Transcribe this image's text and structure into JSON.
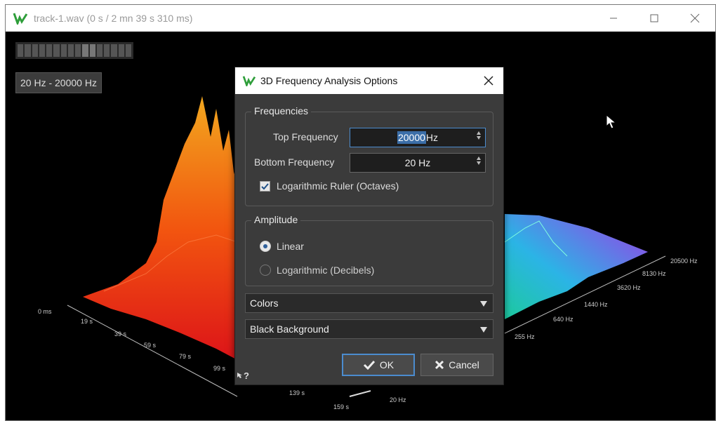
{
  "window": {
    "title": "track-1.wav (0 s / 2 mn 39 s 310 ms)",
    "controls": [
      "minimize",
      "maximize",
      "close"
    ]
  },
  "viewer": {
    "range_button": "20 Hz - 20000 Hz",
    "time_ticks": [
      "0 ms",
      "19 s",
      "39 s",
      "59 s",
      "79 s",
      "99 s",
      "139 s",
      "159 s"
    ],
    "freq_ticks": [
      "20 Hz",
      "255 Hz",
      "640 Hz",
      "1440 Hz",
      "3620 Hz",
      "8130 Hz",
      "20500 Hz"
    ]
  },
  "dialog": {
    "title": "3D Frequency Analysis Options",
    "frequencies": {
      "group_label": "Frequencies",
      "top_label": "Top Frequency",
      "top_value": "20000",
      "top_unit": " Hz",
      "bottom_label": "Bottom Frequency",
      "bottom_value": "20 Hz",
      "log_ruler_label": "Logarithmic Ruler (Octaves)",
      "log_ruler_checked": true
    },
    "amplitude": {
      "group_label": "Amplitude",
      "options": [
        "Linear",
        "Logarithmic (Decibels)"
      ],
      "selected": "Linear"
    },
    "colors_select": "Colors",
    "background_select": "Black Background",
    "ok_label": "OK",
    "cancel_label": "Cancel",
    "help_label": "?"
  },
  "colors": {
    "accent": "#4b8ccf",
    "dialog_bg": "#3b3b3b",
    "logo_green": "#2e9e3a"
  }
}
